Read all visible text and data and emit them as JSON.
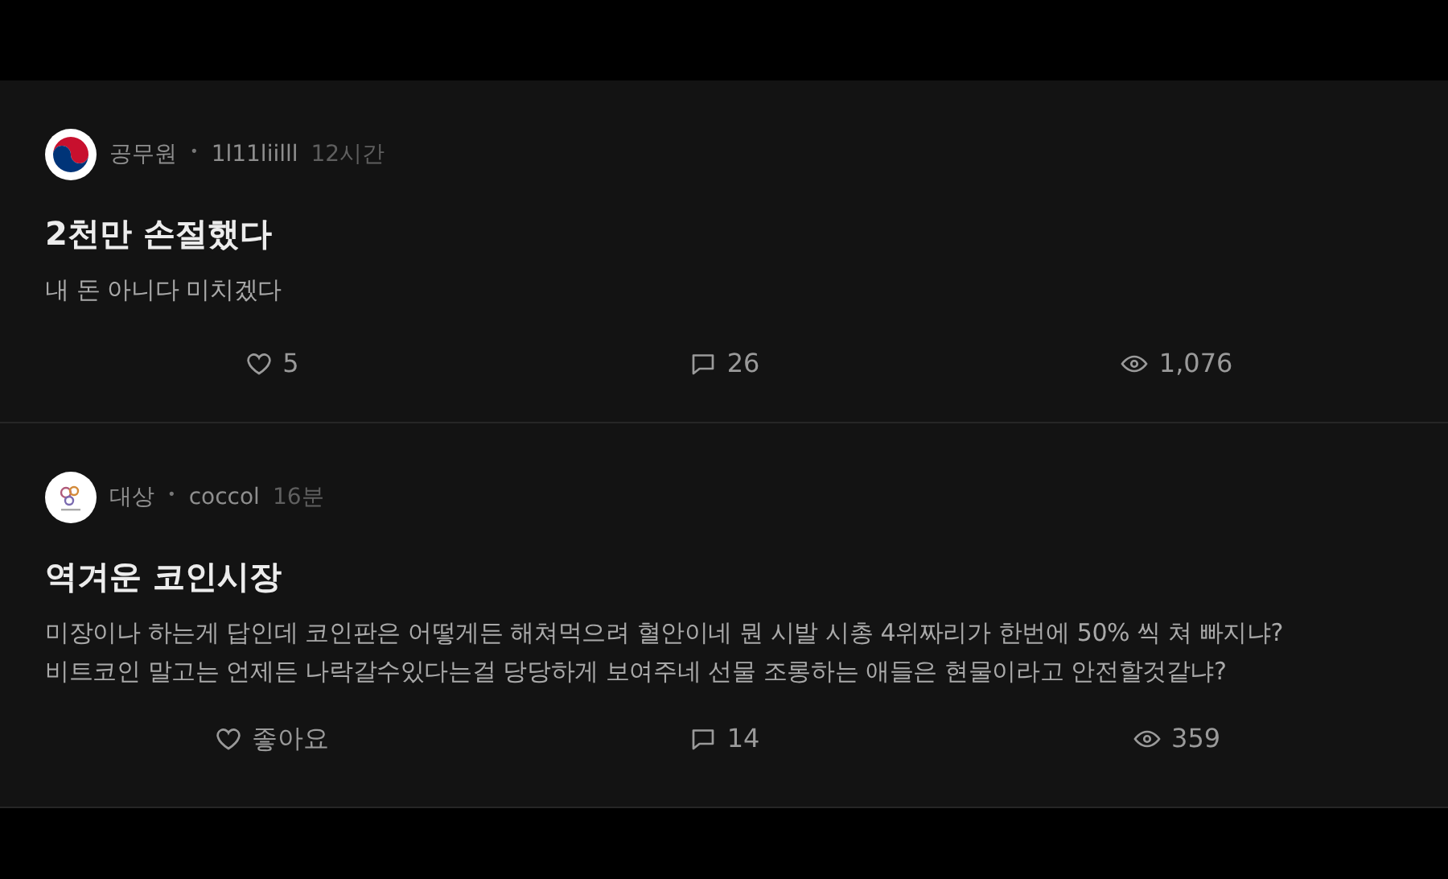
{
  "posts": [
    {
      "avatar": {
        "kind": "emblem"
      },
      "author": "공무원",
      "separator": "•",
      "handle": "1l11liilll",
      "time": "12시간",
      "title": "2천만 손절했다",
      "body": [
        "내 돈 아니다 미치겠다"
      ],
      "likes": "5",
      "comments": "26",
      "views": "1,076"
    },
    {
      "avatar": {
        "kind": "logo"
      },
      "author": "대상",
      "separator": "•",
      "handle": "coccol",
      "time": "16분",
      "title": "역겨운 코인시장",
      "body": [
        "미장이나 하는게 답인데 코인판은 어떻게든 해쳐먹으려 혈안이네 뭔 시발 시총 4위짜리가 한번에 50% 씩 쳐 빠지냐?",
        "비트코인 말고는 언제든 나락갈수있다는걸 당당하게 보여주네 선물 조롱하는 애들은 현물이라고 안전할것같냐?"
      ],
      "likes": "좋아요",
      "comments": "14",
      "views": "359"
    }
  ]
}
